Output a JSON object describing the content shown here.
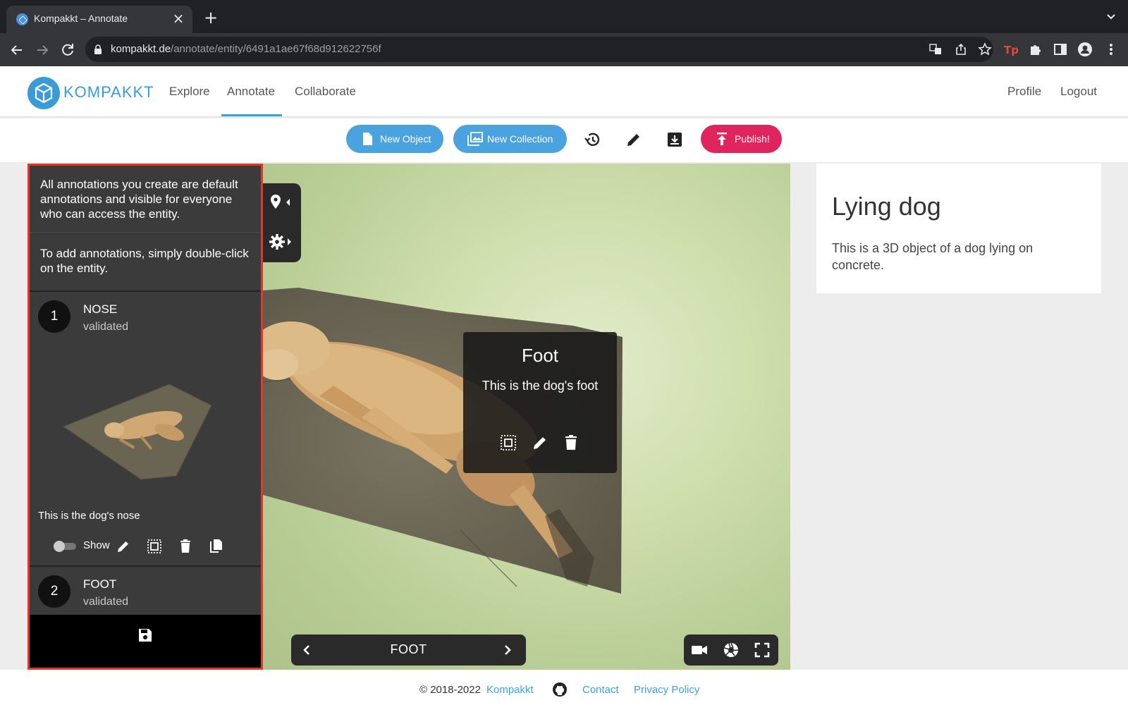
{
  "browser": {
    "tab_title": "Kompakkt – Annotate",
    "url_host": "kompakkt.de",
    "url_path": "/annotate/entity/6491a1ae67f68d912622756f"
  },
  "header": {
    "brand": "KOMPAKKT",
    "nav": [
      "Explore",
      "Annotate",
      "Collaborate"
    ],
    "active_nav": "Annotate",
    "profile": "Profile",
    "logout": "Logout"
  },
  "actions": {
    "new_object": "New Object",
    "new_collection": "New Collection",
    "publish": "Publish!"
  },
  "annotation_panel": {
    "info_1": "All annotations you create are default annotations and visible for everyone who can access the entity.",
    "info_2": "To add annotations, simply double-click on the entity.",
    "items": [
      {
        "number": "1",
        "title": "NOSE",
        "status": "validated",
        "description": "This is the dog's nose",
        "show_label": "Show",
        "show_enabled": false
      },
      {
        "number": "2",
        "title": "FOOT",
        "status": "validated"
      }
    ]
  },
  "viewer": {
    "tooltip": {
      "title": "Foot",
      "description": "This is the dog's foot"
    },
    "current_annotation": "FOOT"
  },
  "entity": {
    "title": "Lying dog",
    "description": "This is a 3D object of a dog lying on concrete."
  },
  "footer": {
    "copyright": "© 2018-2022",
    "brand_link": "Kompakkt",
    "contact": "Contact",
    "privacy": "Privacy Policy"
  },
  "colors": {
    "accent": "#4aa3df",
    "publish": "#e0245e",
    "panel_border": "#e5362b"
  }
}
